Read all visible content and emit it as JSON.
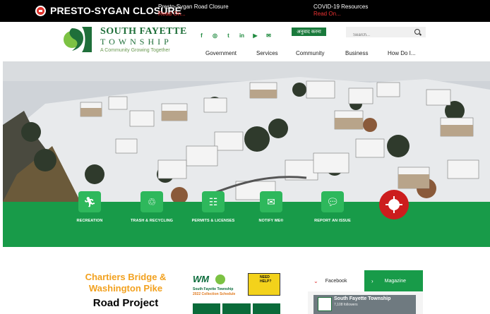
{
  "alert": {
    "title": "PRESTO-SYGAN CLOSURE",
    "items": [
      {
        "title": "Presto-Sygan Road Closure",
        "link": "Read On..."
      },
      {
        "title": "COVID-19 Resources",
        "link": "Read On..."
      }
    ]
  },
  "header": {
    "logo_name": "SOUTH FAYETTE",
    "logo_sub": "TOWNSHIP",
    "tagline": "A Community Growing Together",
    "translate_label": "अनुवाद करना",
    "search_placeholder": "Search...",
    "social": [
      "f",
      "◎",
      "t",
      "in",
      "▶",
      "✉"
    ]
  },
  "nav": [
    "Government",
    "Services",
    "Community",
    "Business",
    "How Do I..."
  ],
  "quick_links": [
    {
      "label": "RECREATION",
      "icon": "runner-icon"
    },
    {
      "label": "TRASH & RECYCLING",
      "icon": "trash-icon"
    },
    {
      "label": "PERMITS & LICENSES",
      "icon": "document-icon"
    },
    {
      "label": "NOTIFY ME®",
      "icon": "mailbox-icon"
    },
    {
      "label": "REPORT AN ISSUE",
      "icon": "chat-icon"
    }
  ],
  "news": {
    "headline_a": "Chartiers Bridge &",
    "headline_b": "Washington Pike",
    "headline_c": "Road Project",
    "wm_logo": "WM",
    "wm_title": "South Fayette Township",
    "wm_subtitle": "2022 Collection Schedule",
    "need_help": "NEED HELP?"
  },
  "social_widget": {
    "tab_facebook": "Facebook",
    "tab_magazine": "Magazine",
    "page_name": "South Fayette Township",
    "followers": "7,108 followers"
  },
  "colors": {
    "brand_green": "#189b49",
    "alert_red": "#e0322b"
  }
}
